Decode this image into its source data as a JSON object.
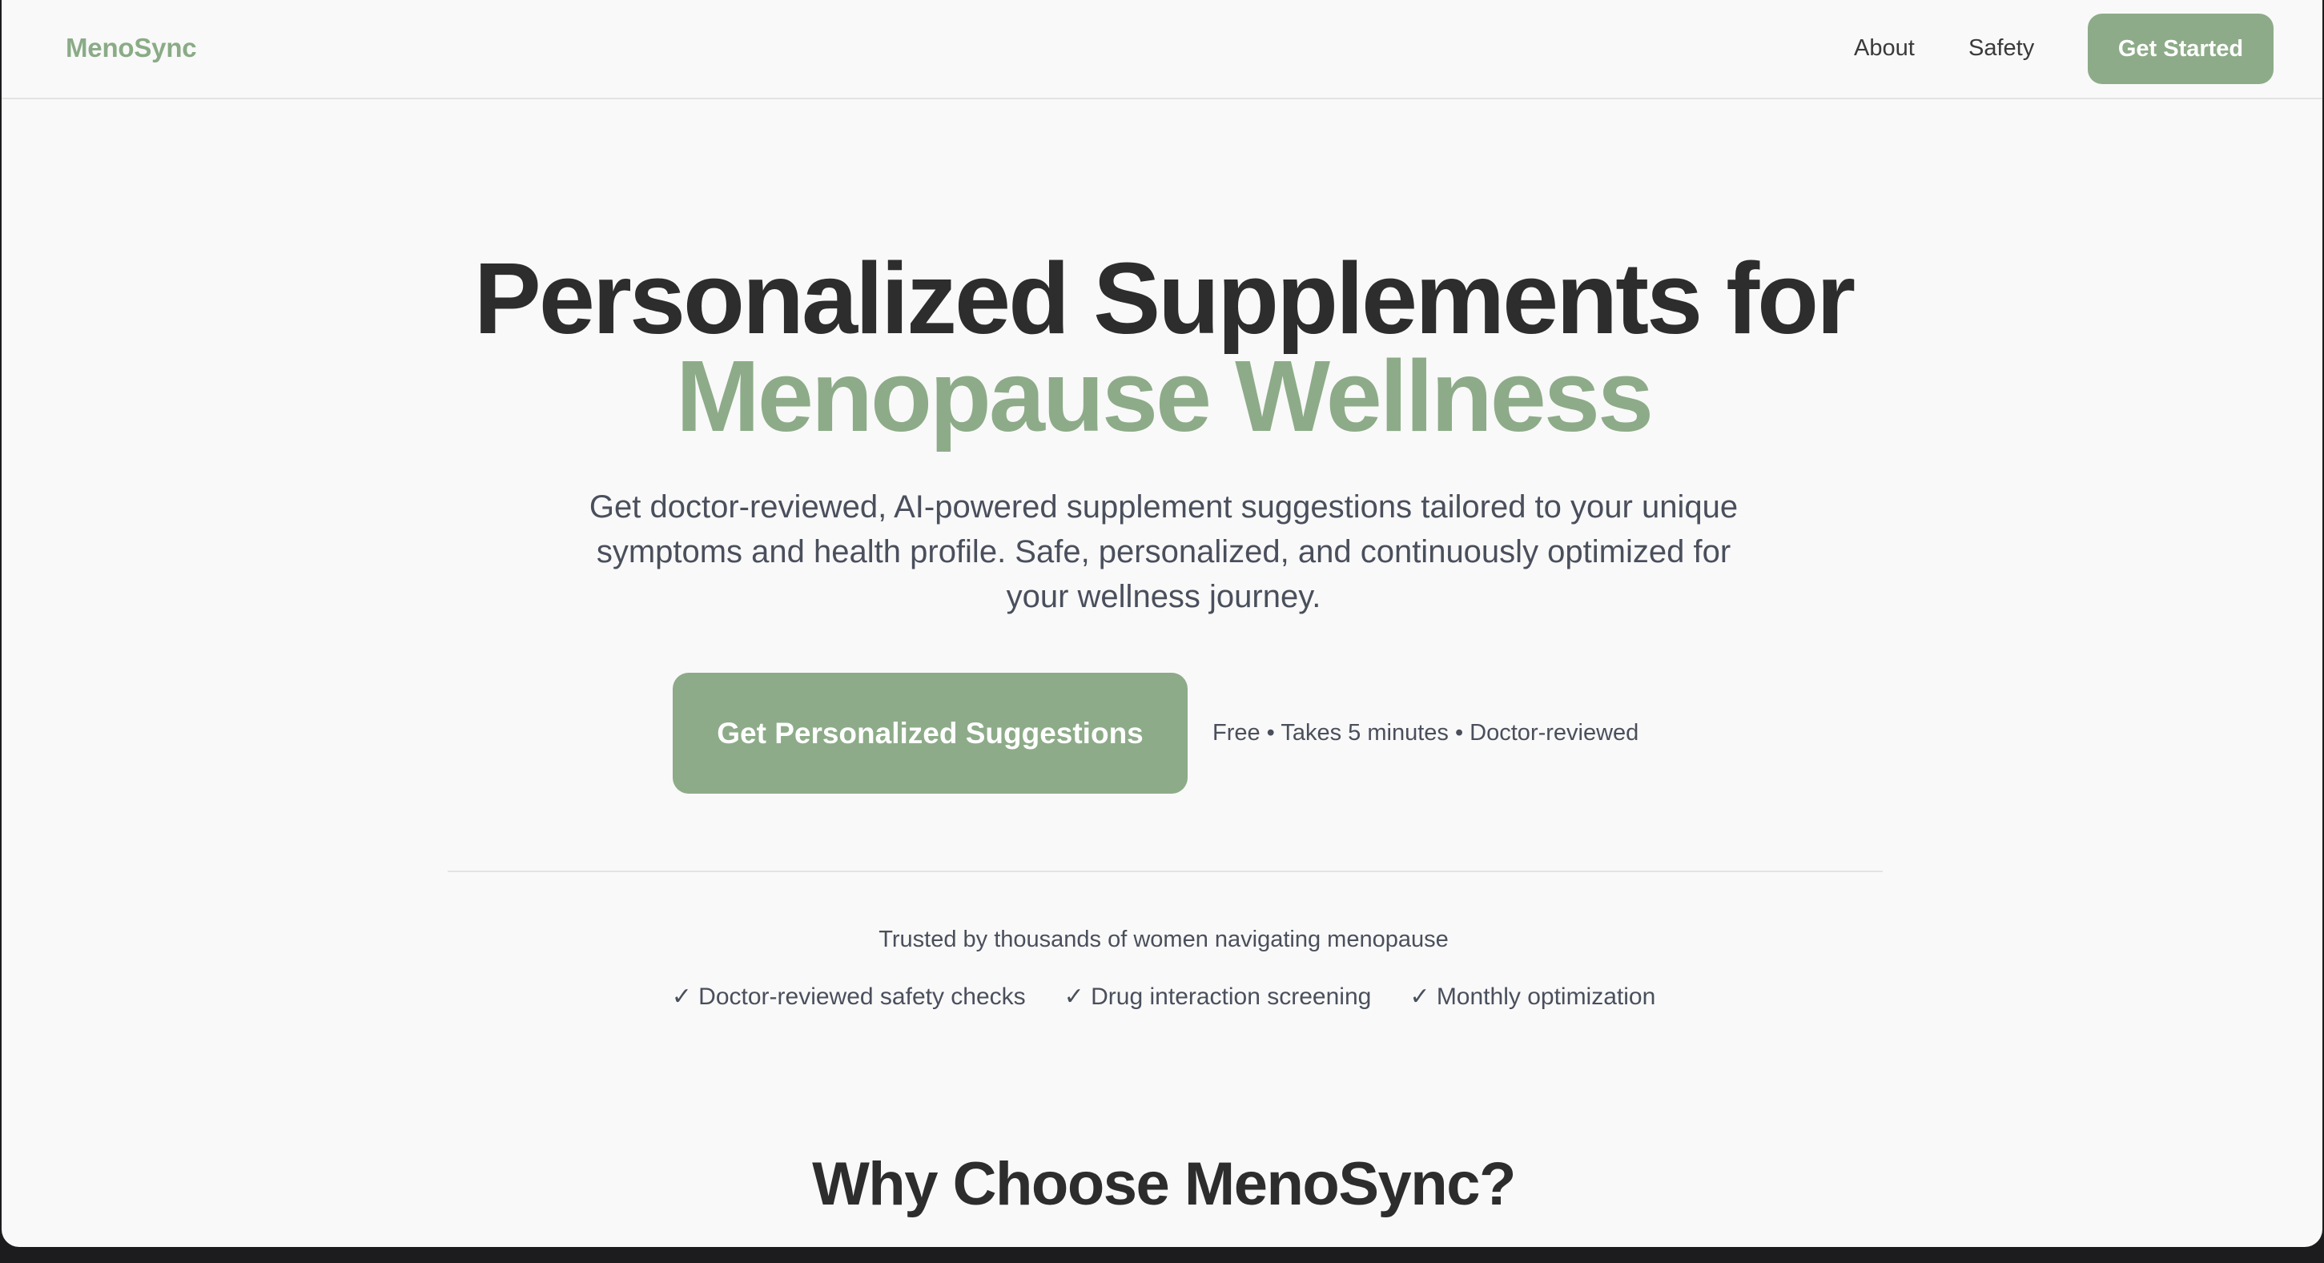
{
  "nav": {
    "logo": "MenoSync",
    "links": [
      {
        "label": "About"
      },
      {
        "label": "Safety"
      }
    ],
    "cta_label": "Get Started"
  },
  "hero": {
    "title_line1": "Personalized Supplements for",
    "title_line2": "Menopause Wellness",
    "subtitle": "Get doctor-reviewed, AI-powered supplement suggestions tailored to your unique symptoms and health profile. Safe, personalized, and continuously optimized for your wellness journey.",
    "cta_label": "Get Personalized Suggestions",
    "cta_note": "Free • Takes 5 minutes • Doctor-reviewed"
  },
  "trust": {
    "text": "Trusted by thousands of women navigating menopause",
    "features": [
      "✓ Doctor-reviewed safety checks",
      "✓ Drug interaction screening",
      "✓ Monthly optimization"
    ]
  },
  "why": {
    "title": "Why Choose MenoSync?"
  },
  "colors": {
    "accent": "#8dab88",
    "heading": "#2d2d2d",
    "body_text": "#4a4f5c",
    "background": "#f9f9f9"
  }
}
